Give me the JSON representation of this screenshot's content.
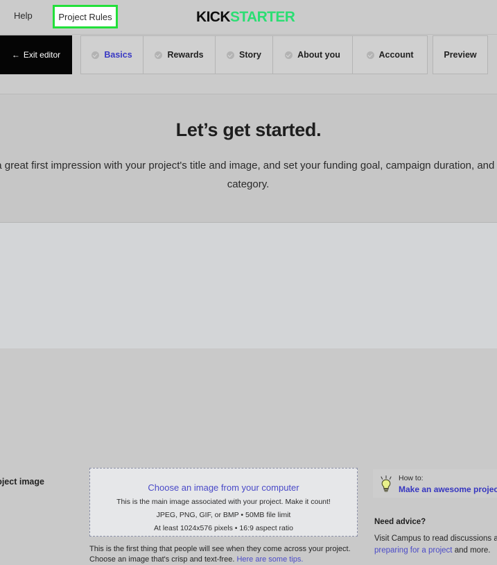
{
  "topbar": {
    "help_label": "Help",
    "project_rules_label": "Project Rules",
    "logo_first": "KICK",
    "logo_second": "STARTER",
    "highlight_color": "#22e03a"
  },
  "nav": {
    "exit_arrow": "←",
    "exit_label": "Exit editor",
    "tabs": [
      {
        "label": "Basics",
        "icon": "check-circle-icon",
        "active": true
      },
      {
        "label": "Rewards",
        "icon": "check-circle-icon",
        "active": false
      },
      {
        "label": "Story",
        "icon": "check-circle-icon",
        "active": false
      },
      {
        "label": "About you",
        "icon": "check-circle-icon",
        "active": false
      },
      {
        "label": "Account",
        "icon": "check-circle-icon",
        "active": false
      }
    ],
    "preview_label": "Preview"
  },
  "hero": {
    "title": "Let’s get started.",
    "subtitle": "Make a great first impression with your project's title and image, and set your funding goal, campaign duration, and project category."
  },
  "main": {
    "field_label": "Project image",
    "dropzone": {
      "link": "Choose an image from your computer",
      "line1": "This is the main image associated with your project. Make it count!",
      "line2": "JPEG, PNG, GIF, or BMP • 50MB file limit",
      "line3": "At least 1024x576 pixels • 16:9 aspect ratio"
    },
    "note_line1": "This is the first thing that people will see when they come across your project.",
    "note_line2": "Choose an image that's crisp and text-free. ",
    "note_link": "Here are some tips.",
    "link_color": "#4a4ac8"
  },
  "sidebar": {
    "howto_icon": "lightbulb-icon",
    "howto_label": "How to:",
    "howto_link": "Make an awesome project",
    "advice_title": "Need advice?",
    "advice_text_1": "Visit Campus to read discussions about ",
    "advice_link": "preparing for a project",
    "advice_text_2": " and more."
  }
}
